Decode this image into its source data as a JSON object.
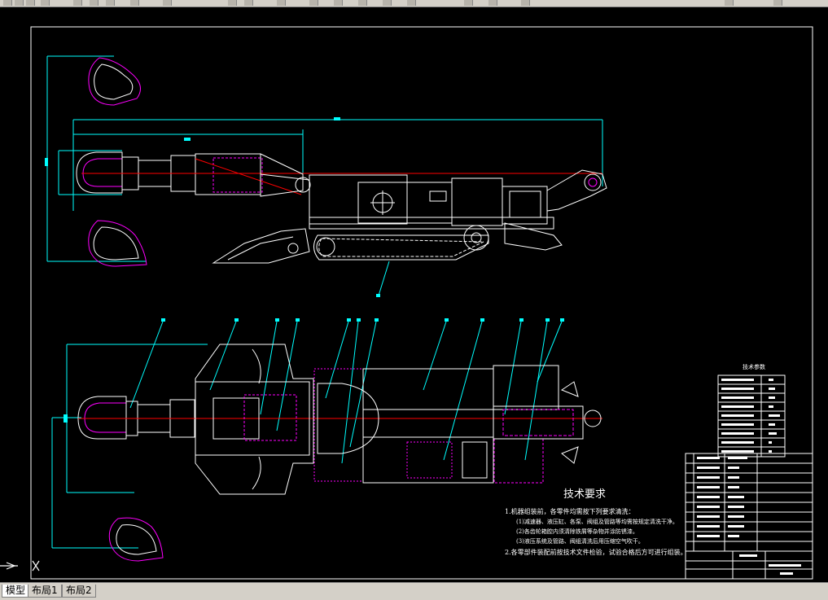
{
  "toolbar": {
    "label": "AutoCAD toolbar"
  },
  "layout_tabs": [
    {
      "label": "模型",
      "active": true
    },
    {
      "label": "布局1",
      "active": false
    },
    {
      "label": "布局2",
      "active": false
    }
  ],
  "drawing": {
    "tech_requirements_title": "技术要求",
    "tech_requirements": [
      "1.机器组装前，各零件均需按下列要求清洗：",
      "(1)减速器、液压缸、各泵、阀组及管路等均需按规定清洗干净。",
      "(2)各齿轮箱腔内须清除铁屑等杂物并涂防锈漆。",
      "(3)液压系统及管路、阀组清洗后用压缩空气吹干。",
      "2.各零部件装配前按技术文件检验，试验合格后方可进行组装。"
    ],
    "tech_params_title": "技术参数",
    "colors": {
      "frame": "#ffffff",
      "dim": "#00ffff",
      "part": "#ffffff",
      "hidden": "#ff00ff",
      "accent": "#ff0000",
      "yellow": "#ffff00"
    }
  }
}
